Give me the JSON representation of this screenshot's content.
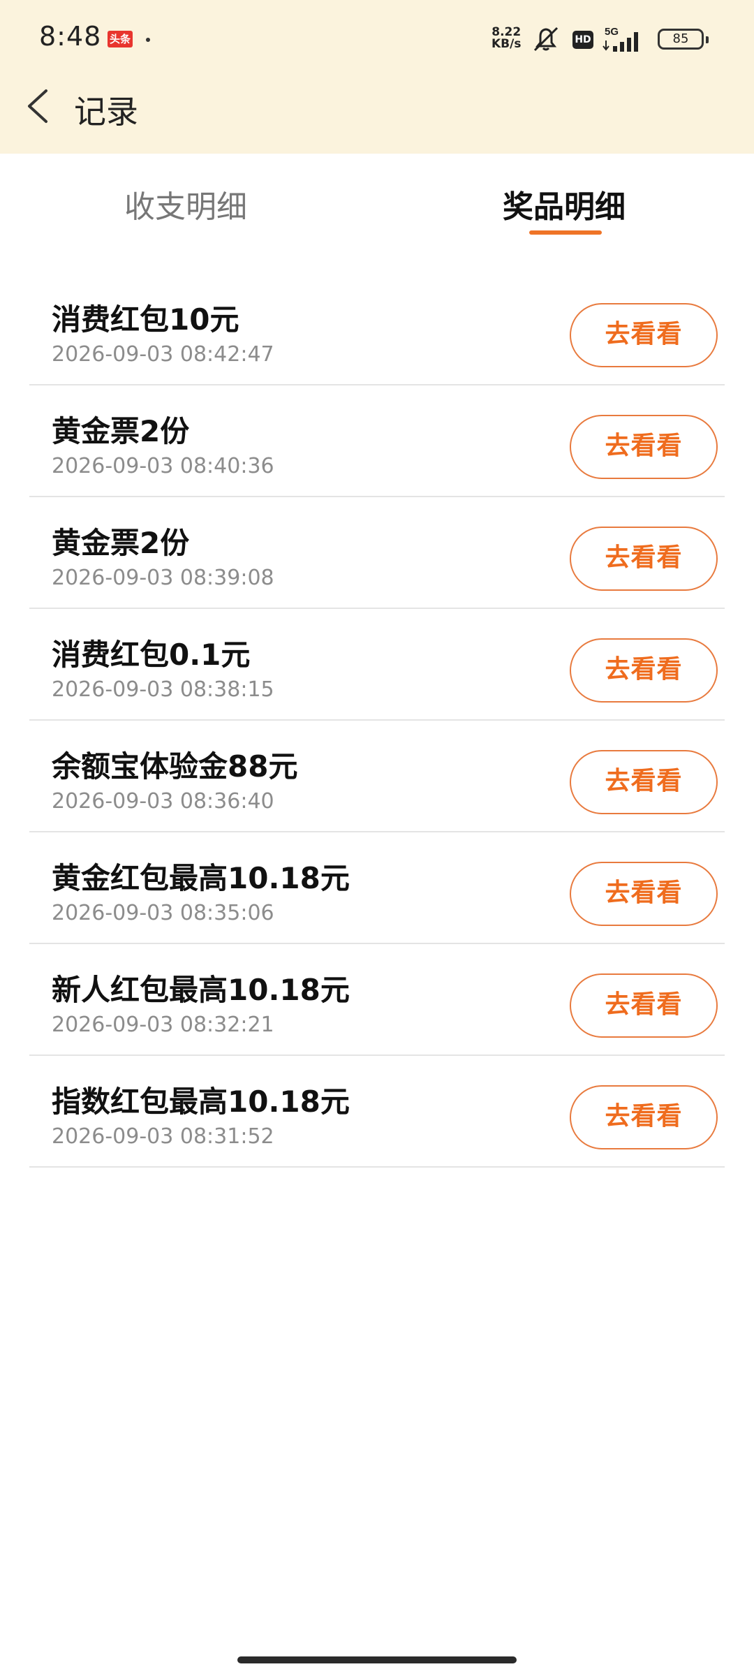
{
  "status": {
    "time": "8:48",
    "app_badge": "头条",
    "net_speed_value": "8.22",
    "net_speed_unit": "KB/s",
    "hd": "HD",
    "network": "5G",
    "battery": "85"
  },
  "header": {
    "title": "记录"
  },
  "tabs": [
    {
      "label": "收支明细",
      "active": false
    },
    {
      "label": "奖品明细",
      "active": true
    }
  ],
  "items": [
    {
      "name": "消费红包10元",
      "time": "2026-09-03 08:42:47",
      "action": "去看看"
    },
    {
      "name": "黄金票2份",
      "time": "2026-09-03 08:40:36",
      "action": "去看看"
    },
    {
      "name": "黄金票2份",
      "time": "2026-09-03 08:39:08",
      "action": "去看看"
    },
    {
      "name": "消费红包0.1元",
      "time": "2026-09-03 08:38:15",
      "action": "去看看"
    },
    {
      "name": "余额宝体验金88元",
      "time": "2026-09-03 08:36:40",
      "action": "去看看"
    },
    {
      "name": "黄金红包最高10.18元",
      "time": "2026-09-03 08:35:06",
      "action": "去看看"
    },
    {
      "name": "新人红包最高10.18元",
      "time": "2026-09-03 08:32:21",
      "action": "去看看"
    },
    {
      "name": "指数红包最高10.18元",
      "time": "2026-09-03 08:31:52",
      "action": "去看看"
    }
  ],
  "colors": {
    "accent": "#ef7427",
    "header_bg": "#fbf3dd",
    "divider": "#e4e4e4",
    "secondary_text": "#8c8c8c"
  }
}
